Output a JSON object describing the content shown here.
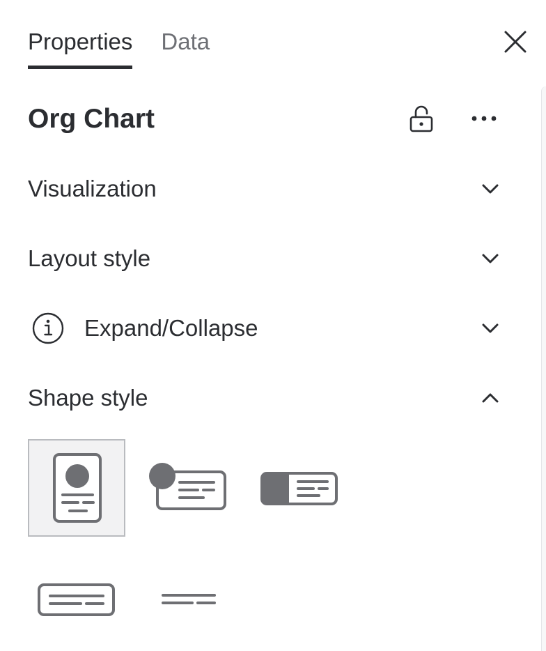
{
  "tabs": [
    {
      "label": "Properties",
      "active": true
    },
    {
      "label": "Data",
      "active": false
    }
  ],
  "header": {
    "title": "Org Chart"
  },
  "sections": {
    "visualization": {
      "label": "Visualization",
      "expanded": false
    },
    "layout_style": {
      "label": "Layout style",
      "expanded": false
    },
    "expand_collapse": {
      "label": "Expand/Collapse",
      "expanded": false,
      "has_info_icon": true
    },
    "shape_style": {
      "label": "Shape style",
      "expanded": true
    }
  },
  "shape_styles": [
    {
      "name": "vertical-card-with-photo",
      "selected": true
    },
    {
      "name": "horizontal-card-with-photo-badge",
      "selected": false
    },
    {
      "name": "card-with-color-block",
      "selected": false
    },
    {
      "name": "text-card",
      "selected": false
    },
    {
      "name": "text-only",
      "selected": false
    }
  ],
  "icons": {
    "close": "close-icon",
    "lock": "unlock-icon",
    "more": "more-horizontal-icon",
    "info": "info-icon",
    "chevron_down": "chevron-down-icon",
    "chevron_up": "chevron-up-icon"
  },
  "colors": {
    "text_primary": "#2b2d31",
    "text_secondary": "#6e7075",
    "icon_gray": "#6e6f73",
    "selected_bg": "#f2f2f3",
    "selected_border": "#b9bbbf"
  }
}
